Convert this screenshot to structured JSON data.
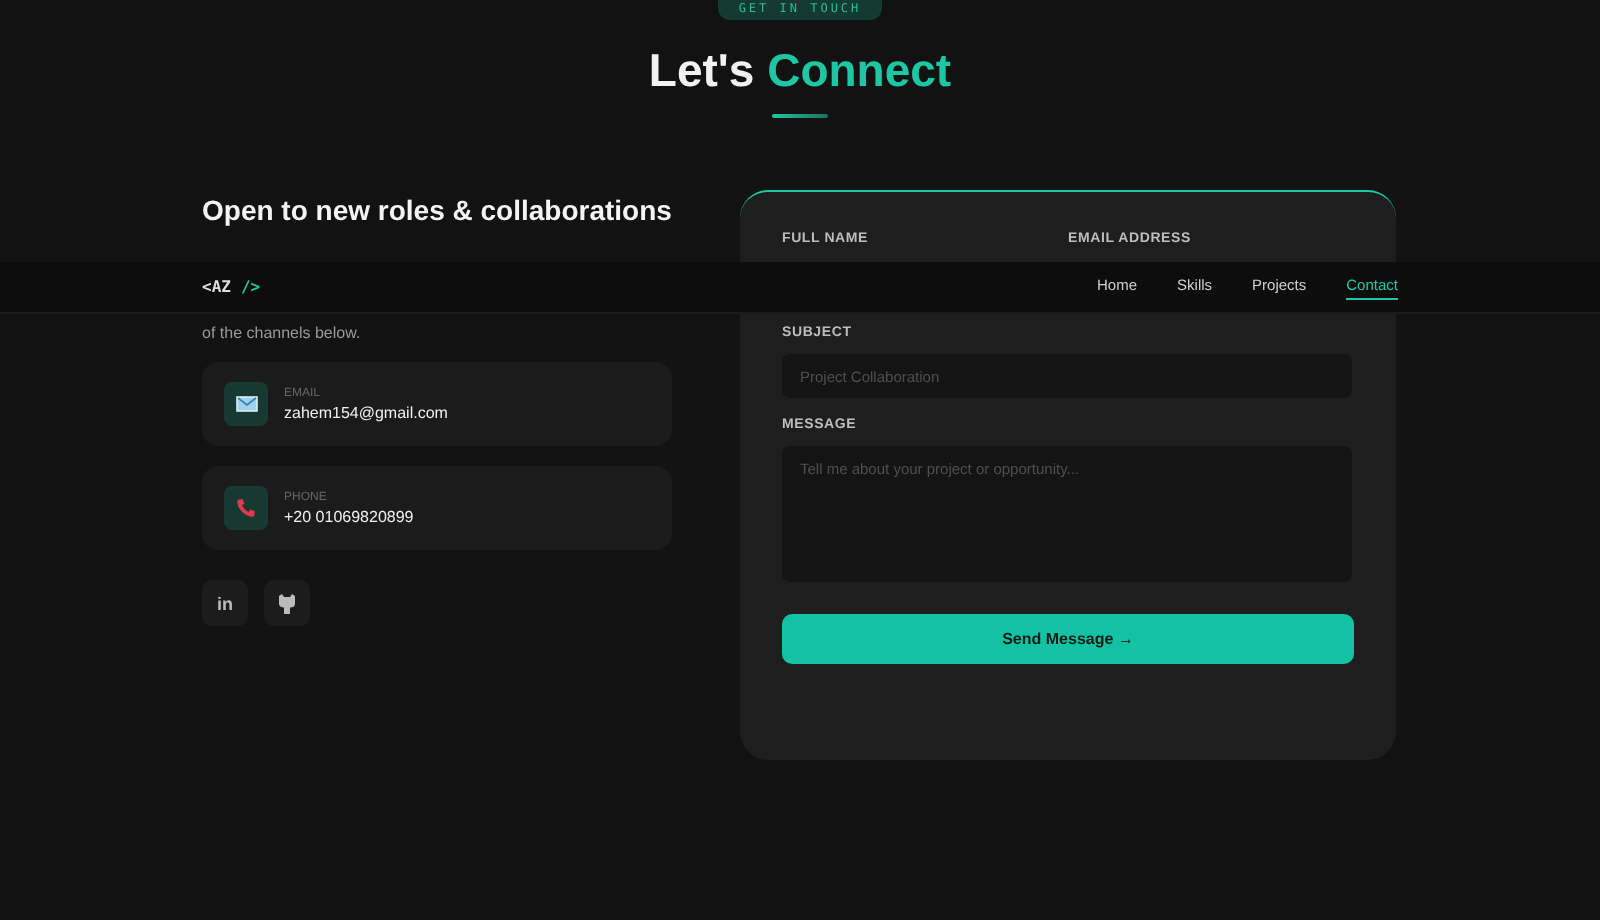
{
  "badge": "GET IN TOUCH",
  "title": {
    "text": "Let's",
    "highlight": "Connect"
  },
  "nav": {
    "logo": {
      "open": "<AZ",
      "close": "/>"
    },
    "links": [
      {
        "label": "Home",
        "selected": false
      },
      {
        "label": "Skills",
        "selected": false
      },
      {
        "label": "Projects",
        "selected": false
      },
      {
        "label": "Contact",
        "selected": true
      }
    ]
  },
  "intro": {
    "heading": "Open to new roles & collaborations",
    "text": "of the channels below."
  },
  "channels": [
    {
      "kind": "email",
      "label": "EMAIL",
      "value": "zahem154@gmail.com"
    },
    {
      "kind": "phone",
      "label": "PHONE",
      "value": "+20 01069820899"
    }
  ],
  "socials": [
    {
      "kind": "linkedin",
      "glyph": "in"
    },
    {
      "kind": "github"
    }
  ],
  "form": {
    "row_labels": [
      "FULL NAME",
      "EMAIL ADDRESS"
    ],
    "subject": {
      "label": "SUBJECT",
      "placeholder": "Project Collaboration"
    },
    "message": {
      "label": "MESSAGE",
      "placeholder": "Tell me about your project or opportunity..."
    },
    "submit": {
      "label": "Send Message",
      "arrow": "→"
    }
  }
}
